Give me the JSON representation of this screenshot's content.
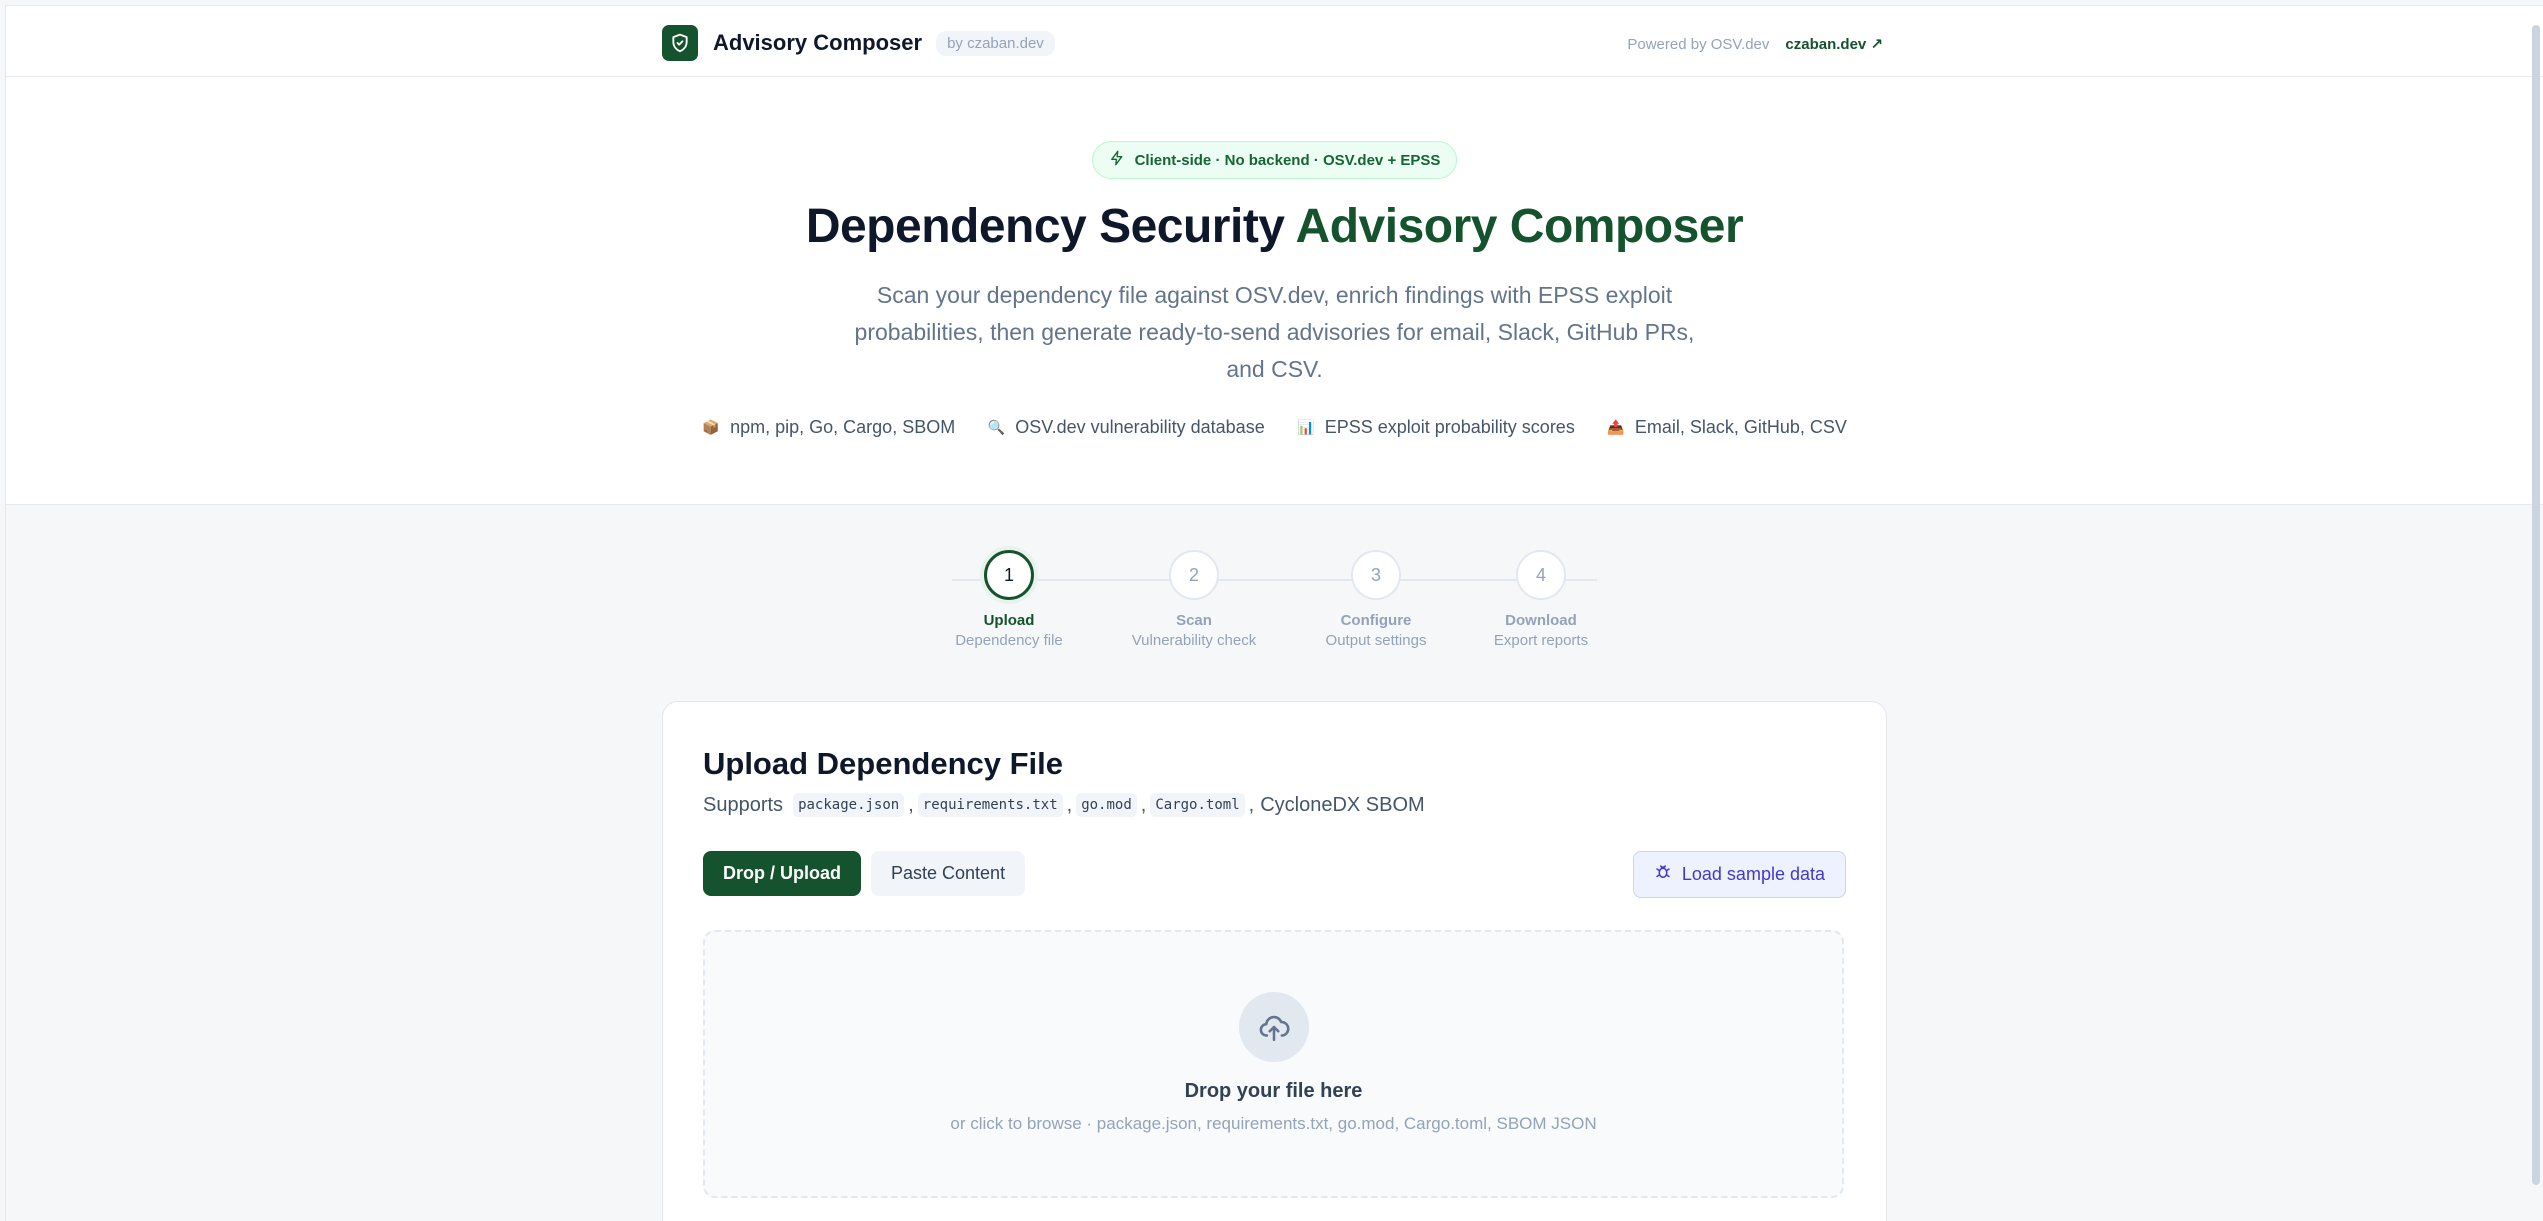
{
  "header": {
    "app_title": "Advisory Composer",
    "by_badge": "by czaban.dev",
    "powered_by": "Powered by OSV.dev",
    "site_link": "czaban.dev ↗"
  },
  "hero": {
    "pill": "Client-side · No backend · OSV.dev + EPSS",
    "title_main": "Dependency Security ",
    "title_accent": "Advisory Composer",
    "description": "Scan your dependency file against OSV.dev, enrich findings with EPSS exploit probabilities, then generate ready-to-send advisories for email, Slack, GitHub PRs, and CSV.",
    "features": [
      {
        "icon": "package-icon",
        "glyph": "📦",
        "label": "npm, pip, Go, Cargo, SBOM"
      },
      {
        "icon": "magnifier-icon",
        "glyph": "🔍",
        "label": "OSV.dev vulnerability database"
      },
      {
        "icon": "chart-icon",
        "glyph": "📊",
        "label": "EPSS exploit probability scores"
      },
      {
        "icon": "outbox-icon",
        "glyph": "📤",
        "label": "Email, Slack, GitHub, CSV"
      }
    ]
  },
  "steps": [
    {
      "number": "1",
      "label": "Upload",
      "sub": "Dependency file",
      "active": true
    },
    {
      "number": "2",
      "label": "Scan",
      "sub": "Vulnerability check",
      "active": false
    },
    {
      "number": "3",
      "label": "Configure",
      "sub": "Output settings",
      "active": false
    },
    {
      "number": "4",
      "label": "Download",
      "sub": "Export reports",
      "active": false
    }
  ],
  "upload_card": {
    "title": "Upload Dependency File",
    "supports_prefix": "Supports",
    "formats": [
      "package.json",
      "requirements.txt",
      "go.mod",
      "Cargo.toml"
    ],
    "supports_suffix": "CycloneDX SBOM",
    "tabs": [
      "Drop / Upload",
      "Paste Content"
    ],
    "active_tab": "Drop / Upload",
    "sample_button": "Load sample data",
    "dropzone_title": "Drop your file here",
    "dropzone_sub": "or click to browse · package.json, requirements.txt, go.mod, Cargo.toml, SBOM JSON"
  },
  "colors": {
    "brand": "#14532d",
    "accent_indigo": "#4338ca",
    "muted": "#94a3b8"
  }
}
